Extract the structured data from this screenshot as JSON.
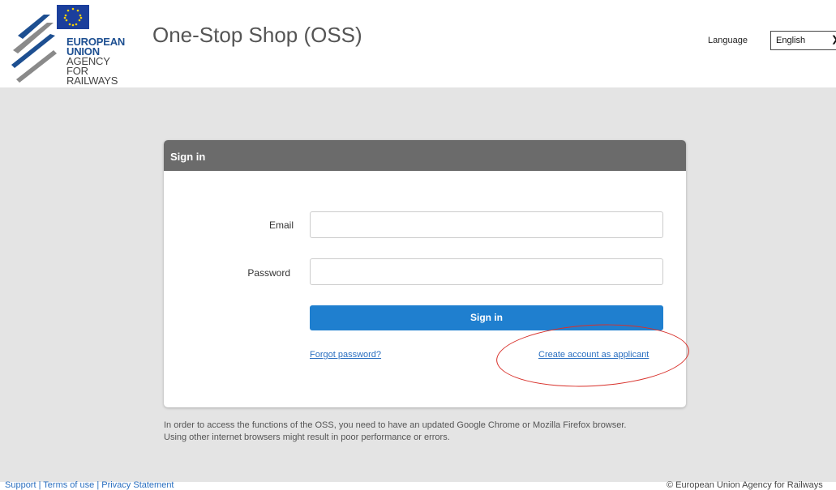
{
  "header": {
    "logo_lines": [
      "EUROPEAN",
      "UNION",
      "AGENCY",
      "FOR RAILWAYS"
    ],
    "app_title": "One-Stop Shop (OSS)",
    "language_label": "Language",
    "language_selected": "English"
  },
  "signin": {
    "title": "Sign in",
    "email_label": "Email",
    "password_label": "Password",
    "submit_label": "Sign in",
    "forgot_link": "Forgot password?",
    "create_link": "Create account as applicant"
  },
  "notice": {
    "line1": "In order to access the functions of the OSS, you need to have an updated Google Chrome or Mozilla Firefox browser.",
    "line2": "Using other internet browsers might result in poor performance or errors."
  },
  "footer": {
    "links": "Support | Terms of use | Privacy Statement",
    "copyright": "© European Union Agency for Railways"
  },
  "colors": {
    "primary_button": "#1f7fcf",
    "card_header": "#6b6b6b",
    "background": "#e4e4e4",
    "annotation": "#d8302a"
  }
}
